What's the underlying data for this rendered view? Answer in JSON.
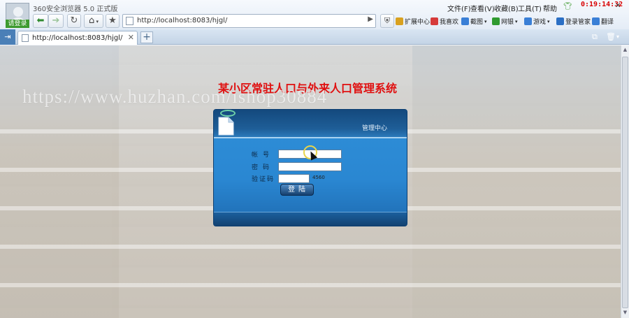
{
  "browser": {
    "app_title": "360安全浏览器 5.0 正式版",
    "login_badge": "请登录",
    "url": "http://localhost:8083/hjgl/",
    "menus": [
      "文件(F)",
      "查看(V)",
      "收藏(B)",
      "工具(T)",
      "帮助"
    ],
    "clock": "0:19:14:32",
    "toolbar": [
      {
        "label": "扩展中心",
        "color": "#d9a11f"
      },
      {
        "label": "我喜欢",
        "color": "#d63a3a"
      },
      {
        "label": "截图",
        "color": "#3a7fd6"
      },
      {
        "label": "网银",
        "color": "#2f9a2f"
      },
      {
        "label": "游戏",
        "color": "#3a7fd6"
      },
      {
        "label": "登录管家",
        "color": "#2b6fc4"
      },
      {
        "label": "翻译",
        "color": "#3a7fd6"
      }
    ],
    "tab": {
      "title": "http://localhost:8083/hjgl/"
    }
  },
  "page": {
    "heading": "某小区常驻人口与外来人口管理系统",
    "watermark": "https://www.huzhan.com/ishop30884"
  },
  "login": {
    "panel_title": "管理中心",
    "labels": {
      "account": "帐号",
      "password": "密码",
      "captcha": "验证码"
    },
    "captcha_code": "4560",
    "submit_label": "登陆"
  }
}
